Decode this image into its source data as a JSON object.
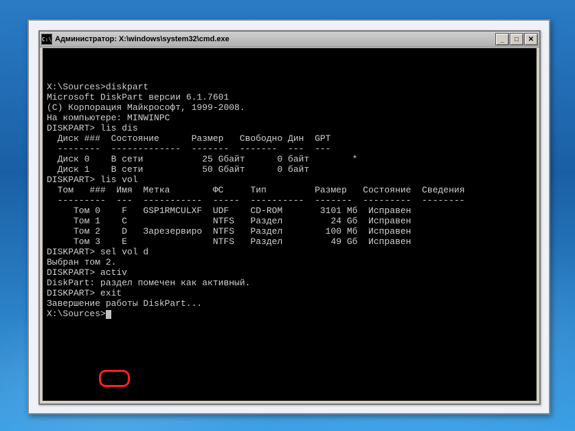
{
  "window": {
    "title": "Администратор: X:\\windows\\system32\\cmd.exe",
    "icon_glyph": "C:\\"
  },
  "buttons": {
    "minimize": "_",
    "maximize": "□",
    "close": "✕"
  },
  "terminal": {
    "lines": [
      "",
      "X:\\Sources>diskpart",
      "",
      "Microsoft DiskPart версии 6.1.7601",
      "(C) Корпорация Майкрософт, 1999-2008.",
      "На компьютере: MINWINPC",
      "",
      "DISKPART> lis dis",
      "",
      "  Диск ###  Состояние      Размер   Свободно Дин  GPT",
      "  --------  -------------  -------  -------  ---  ---",
      "  Диск 0    В сети           25 Gбайт      0 байт        *",
      "  Диск 1    В сети           50 Gбайт      0 байт",
      "",
      "DISKPART> lis vol",
      "",
      "  Том   ###  Имя  Метка        ФС     Тип         Размер   Состояние  Сведения",
      "  ---------  ---  -----------  -----  ----------  -------  ---------  --------",
      "     Том 0    F   GSP1RMCULXF  UDF    CD-ROM       3101 Mб  Исправен",
      "     Том 1    C                NTFS   Раздел         24 Gб  Исправен",
      "     Том 2    D   Зарезервиро  NTFS   Раздел        100 Mб  Исправен",
      "     Том 3    E                NTFS   Раздел         49 Gб  Исправен",
      "",
      "DISKPART> sel vol d",
      "",
      "Выбран том 2.",
      "",
      "DISKPART> activ",
      "",
      "DiskPart: раздел помечен как активный.",
      "",
      "DISKPART> exit",
      "",
      "Завершение работы DiskPart...",
      "",
      "X:\\Sources>"
    ]
  },
  "highlight": {
    "target_text": "exit",
    "line_index": 31
  }
}
